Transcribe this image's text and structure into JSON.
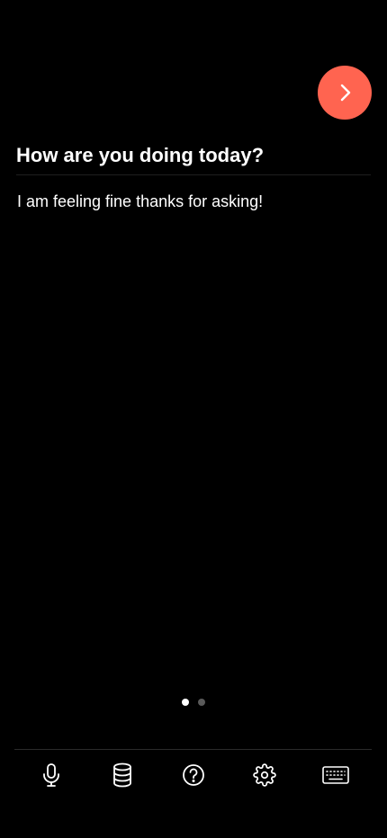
{
  "colors": {
    "accent": "#ff6450",
    "background": "#000000",
    "text": "#ffffff",
    "dot_inactive": "#5a5a5a"
  },
  "next_button": {
    "icon": "chevron-right-icon"
  },
  "question": {
    "text": "How are you doing today?"
  },
  "answer": {
    "text": "I am feeling fine thanks for asking!"
  },
  "pagination": {
    "current": 1,
    "total": 2
  },
  "tabbar": {
    "items": [
      {
        "icon": "microphone-icon"
      },
      {
        "icon": "database-icon"
      },
      {
        "icon": "help-icon"
      },
      {
        "icon": "settings-icon"
      },
      {
        "icon": "keyboard-icon"
      }
    ]
  }
}
